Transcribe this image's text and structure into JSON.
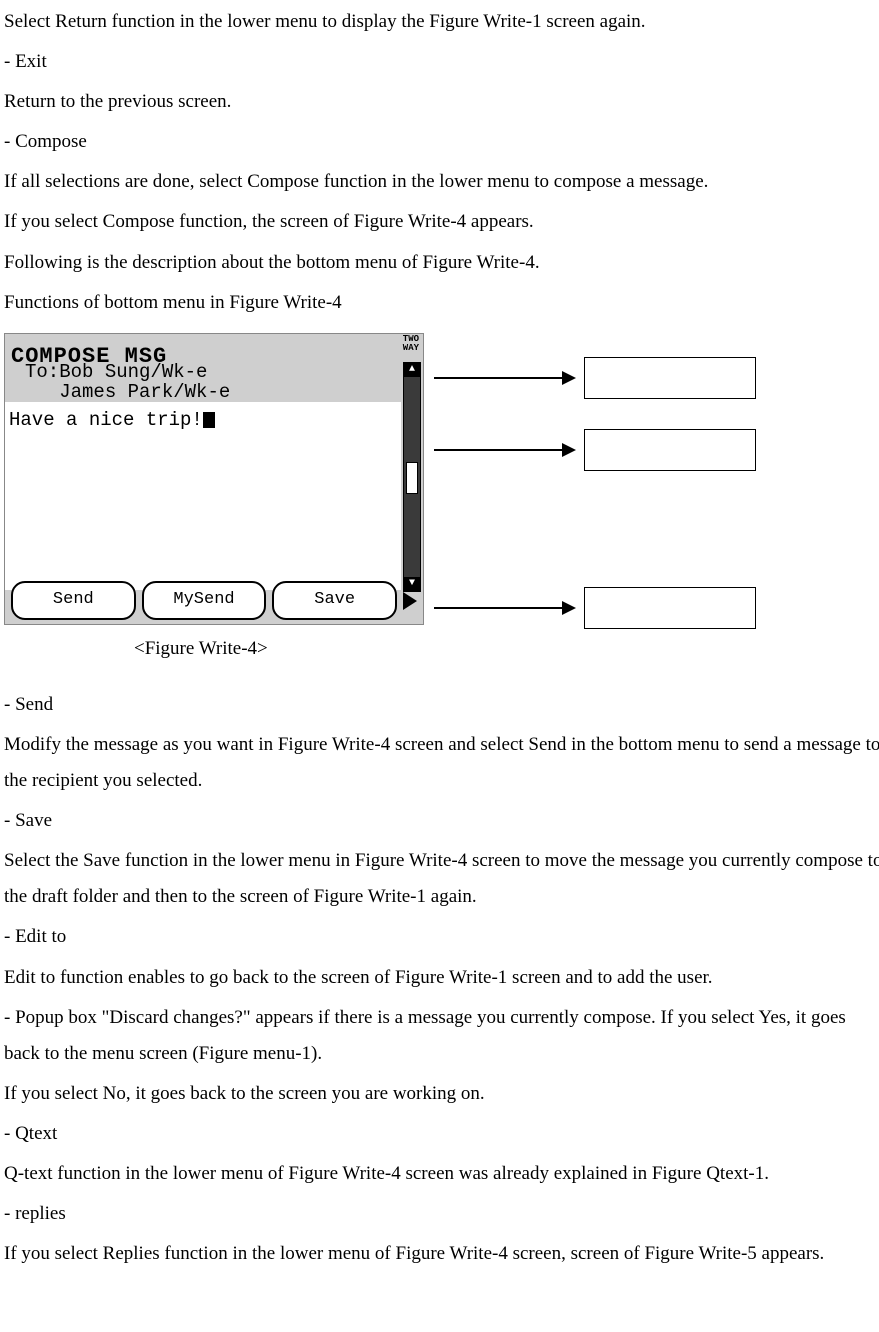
{
  "intro": {
    "p1": "Select Return function in the lower menu to display the Figure Write-1 screen again.",
    "exit_label": "- Exit",
    "exit_desc": "Return to the previous screen.",
    "compose_label": "- Compose",
    "compose_desc1": "If all selections are done, select Compose function in the lower menu to compose a message.",
    "compose_desc2": "If you select Compose function, the screen of Figure Write-4 appears.",
    "compose_desc3": "Following is the description about the bottom menu of Figure Write-4.",
    "functions_heading": "Functions of bottom menu in Figure Write-4"
  },
  "device": {
    "title": "COMPOSE MSG",
    "indicator_line1": "TWO",
    "indicator_line2": "WAY",
    "to_prefix": "To:",
    "recipient1": "Bob Sung/Wk-e",
    "recipient2": "James Park/Wk-e",
    "message_body": "Have a nice trip!",
    "menu": {
      "send": "Send",
      "mysend": "MySend",
      "save": "Save"
    }
  },
  "figure_caption": "<Figure Write-4>",
  "body": {
    "send_label": "- Send",
    "send_desc": "Modify the message as you want in Figure Write-4 screen and select Send in the bottom menu to send a message to the recipient you selected.",
    "save_label": "- Save",
    "save_desc": "Select the Save function in the lower menu in Figure Write-4 screen to move the message you currently compose to the draft folder and then to the screen of Figure Write-1 again.",
    "editto_label": "- Edit to",
    "editto_desc": "Edit to function enables to go back to the screen of Figure Write-1 screen and to add the user.",
    "popup_desc": "- Popup box \"Discard changes?\" appears if there is a message you currently compose. If you select Yes, it goes back to the menu screen (Figure menu-1).",
    "popup_no": "If you select No, it goes back to the screen you are working on.",
    "qtext_label": "- Qtext",
    "qtext_desc": "Q-text function in the lower menu of Figure Write-4 screen was already explained in Figure Qtext-1.",
    "replies_label": "- replies",
    "replies_desc": "If you select Replies function in the lower menu of Figure Write-4 screen, screen of Figure Write-5 appears."
  }
}
